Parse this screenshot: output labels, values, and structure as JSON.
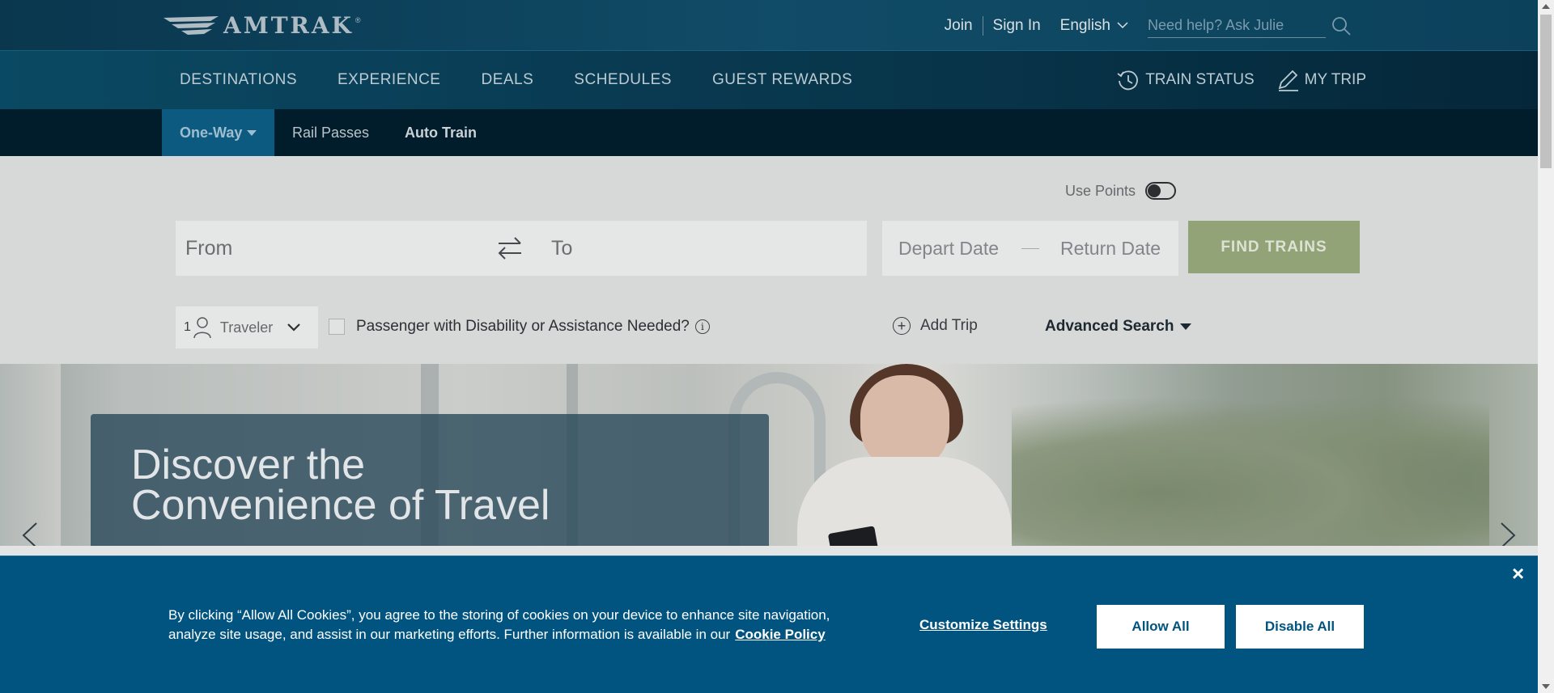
{
  "brand": {
    "name": "AMTRAK",
    "reg_mark": "®"
  },
  "utility": {
    "join": "Join",
    "sign_in": "Sign In",
    "language": "English",
    "search_placeholder": "Need help? Ask Julie"
  },
  "main_nav": {
    "items": [
      "DESTINATIONS",
      "EXPERIENCE",
      "DEALS",
      "SCHEDULES",
      "GUEST REWARDS"
    ],
    "train_status": "TRAIN STATUS",
    "my_trip": "MY TRIP"
  },
  "trip_tabs": {
    "one_way": "One-Way",
    "rail_passes": "Rail Passes",
    "auto_train": "Auto Train"
  },
  "booking": {
    "use_points": "Use Points",
    "from_placeholder": "From",
    "to_placeholder": "To",
    "depart_date": "Depart Date",
    "return_date": "Return Date",
    "find_trains": "FIND TRAINS",
    "traveler_count": "1",
    "traveler_label": "Traveler",
    "disability_label": "Passenger with Disability or Assistance Needed?",
    "info_glyph": "i",
    "add_trip": "Add Trip",
    "advanced_search": "Advanced Search"
  },
  "hero": {
    "headline_line1": "Discover the",
    "headline_line2": "Convenience of Travel"
  },
  "cookie_banner": {
    "close": "×",
    "text": "By clicking “Allow All Cookies”, you agree to the storing of cookies on your device to enhance site navigation, analyze site usage, and assist in our marketing efforts. Further information is available in our",
    "policy_link": "Cookie Policy",
    "customize": "Customize Settings",
    "allow_all": "Allow All",
    "disable_all": "Disable All"
  },
  "colors": {
    "find_trains_bg": "#9aac7e",
    "cookie_bg": "#01547f",
    "active_tab_bg": "#0e5f88"
  }
}
